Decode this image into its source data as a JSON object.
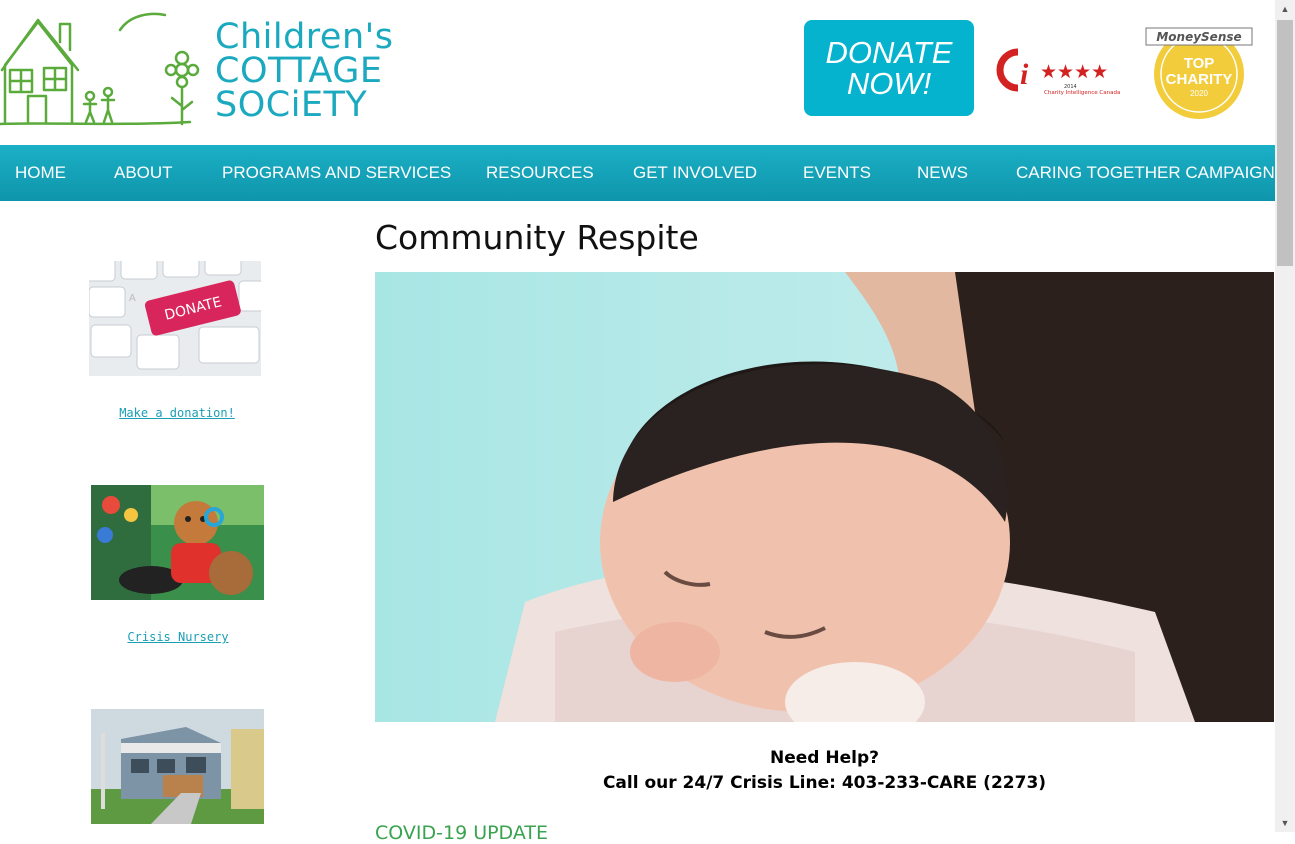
{
  "logo": {
    "line1": "Children's",
    "line2": "COTTAGE",
    "line3": "SOCiETY"
  },
  "donate": {
    "line1": "DONATE",
    "line2": "NOW!"
  },
  "badges": {
    "ci": {
      "year": "2014",
      "caption": "Charity Intelligence Canada"
    },
    "moneysense": {
      "brand": "MoneySense",
      "line1": "TOP",
      "line2": "CHARITY",
      "year": "2020"
    }
  },
  "nav": {
    "items": [
      {
        "label": "HOME"
      },
      {
        "label": "ABOUT"
      },
      {
        "label": "PROGRAMS AND SERVICES"
      },
      {
        "label": "RESOURCES"
      },
      {
        "label": "GET INVOLVED"
      },
      {
        "label": "EVENTS"
      },
      {
        "label": "NEWS"
      },
      {
        "label": "CARING TOGETHER CAMPAIGN"
      }
    ]
  },
  "sidebar": {
    "items": [
      {
        "label": "Make a donation!",
        "key_text": "DONATE"
      },
      {
        "label": "Crisis Nursery"
      }
    ]
  },
  "main": {
    "title": "Community Respite",
    "help_line1": "Need Help?",
    "help_line2": "Call our 24/7 Crisis Line: 403-233-CARE (2273)",
    "covid_heading": "COVID-19 UPDATE"
  },
  "colors": {
    "brand_teal": "#1aa9bf",
    "nav_teal": "#1bb0c6",
    "donate_bg": "#05b3cf",
    "logo_green": "#5aaa3c"
  }
}
